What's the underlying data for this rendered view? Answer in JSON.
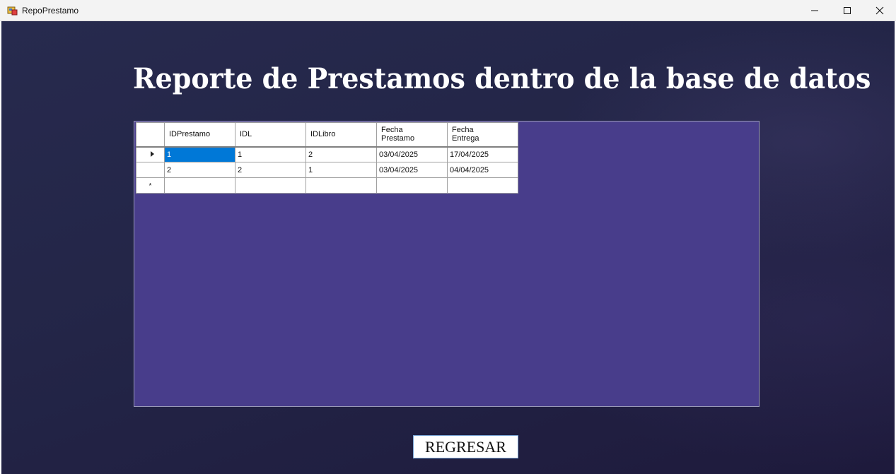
{
  "window": {
    "title": "RepoPrestamo",
    "controls": [
      "minimize",
      "maximize",
      "close"
    ]
  },
  "heading": "Reporte de Prestamos dentro de la base de datos",
  "grid": {
    "columns": [
      {
        "label_line1": "IDPrestamo",
        "label_line2": ""
      },
      {
        "label_line1": "IDL",
        "label_line2": ""
      },
      {
        "label_line1": "IDLibro",
        "label_line2": ""
      },
      {
        "label_line1": "Fecha",
        "label_line2": "Prestamo"
      },
      {
        "label_line1": "Fecha",
        "label_line2": "Entrega"
      }
    ],
    "rows": [
      [
        "1",
        "1",
        "2",
        "03/04/2025",
        "17/04/2025"
      ],
      [
        "2",
        "2",
        "1",
        "03/04/2025",
        "04/04/2025"
      ]
    ],
    "new_row_marker": "*",
    "selected_row": 0,
    "selected_col": 0
  },
  "buttons": {
    "back_label": "REGRESAR"
  },
  "colors": {
    "background": "#232547",
    "grid_panel": "#483d8b",
    "selection": "#0078d7"
  }
}
